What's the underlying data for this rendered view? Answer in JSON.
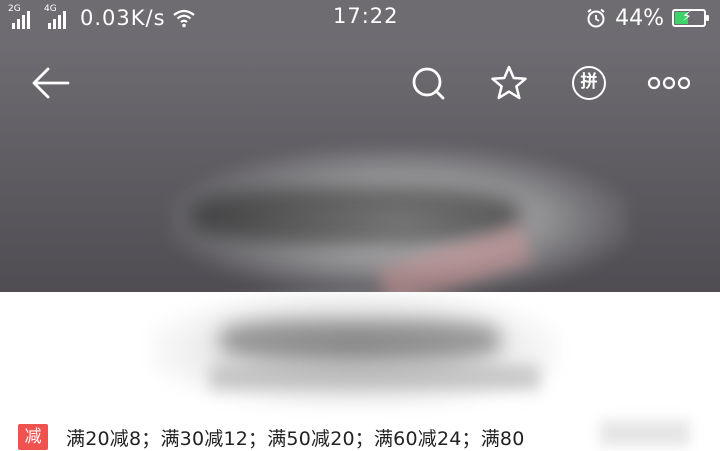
{
  "status_bar": {
    "signal_1_label": "2G",
    "signal_2_label": "4G",
    "net_speed": "0.03K/s",
    "time": "17:22",
    "battery_percent": "44%",
    "battery_level": 0.44,
    "icons": [
      "signal-icon",
      "wifi-icon",
      "alarm-icon",
      "battery-charging-icon"
    ]
  },
  "nav": {
    "icons": [
      "back-arrow-icon",
      "search-icon",
      "star-icon",
      "pin-group-icon",
      "more-icon"
    ],
    "pin_label": "拼"
  },
  "promo": {
    "badge": "减",
    "text": "满20减8；满30减12；满50减20；满60减24；满80"
  },
  "colors": {
    "status_bar_bg": "#6e6c70",
    "badge_red": "#f0524f",
    "battery_green": "#3fd26a"
  }
}
